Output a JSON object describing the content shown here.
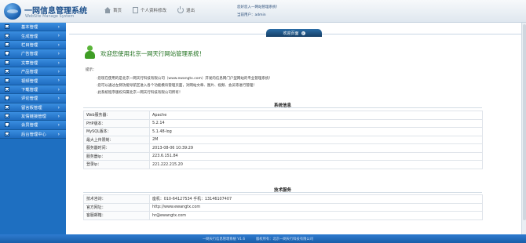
{
  "header": {
    "title": "一网信息管理系统",
    "subtitle": "WebSite Manage System",
    "nav": [
      {
        "label": "首页",
        "icon": "home-icon"
      },
      {
        "label": "个人资料修改",
        "icon": "document-icon"
      },
      {
        "label": "退出",
        "icon": "power-icon"
      }
    ],
    "welcome": "您好您入一网站管理系统！",
    "user_label": "当前用户：admin"
  },
  "sidebar": {
    "items": [
      {
        "label": "基本管理"
      },
      {
        "label": "生成管理"
      },
      {
        "label": "栏目管理"
      },
      {
        "label": "广告管理"
      },
      {
        "label": "文章管理"
      },
      {
        "label": "产品管理"
      },
      {
        "label": "视频管理"
      },
      {
        "label": "下载管理"
      },
      {
        "label": "评论管理"
      },
      {
        "label": "留言板管理"
      },
      {
        "label": "友情链接管理"
      },
      {
        "label": "会员管理"
      },
      {
        "label": "后台管理中心"
      }
    ]
  },
  "tab": {
    "label": "欢迎页面"
  },
  "welcome": {
    "title": "欢迎您使用北京一网天行网站管理系统！",
    "tips_label": "提示：",
    "tips": [
      "·您现在使用的是北京一网天行科技有限公司（www.ewangtx.com）开发的信息网门户型网站的专业管理系统！",
      "·您可以通过左侧功能导航区进入各个功能模块管理页面，对网站文章、图片、视频、会员等进行管理！",
      "·此系统程序版权归属北京一网天行科技有限公司所有！"
    ]
  },
  "system_info": {
    "title": "系统信息",
    "rows": [
      {
        "key": "Web服务器：",
        "value": "Apache"
      },
      {
        "key": "PHP版本：",
        "value": "5.2.14"
      },
      {
        "key": "MySQL版本：",
        "value": "5.1.48-log"
      },
      {
        "key": "最大上传限制：",
        "value": "2M"
      },
      {
        "key": "服务器时间：",
        "value": "2013-08-06 10:39:29"
      },
      {
        "key": "服务器ip：",
        "value": "223.6.151.84"
      },
      {
        "key": "登录ip：",
        "value": "221.222.215.20"
      }
    ]
  },
  "tech_support": {
    "title": "技术服务",
    "rows": [
      {
        "key": "技术咨询：",
        "value": "座机：010-64127534    手机：13146107407"
      },
      {
        "key": "官方网址：",
        "value": "http://www.ewangtx.com"
      },
      {
        "key": "客服邮箱：",
        "value": "hr@ewangtx.com"
      }
    ]
  },
  "footer": {
    "left": "一网天行信息管理系统 V1.6",
    "right": "版权所有：北京一网天行科技有限公司"
  }
}
